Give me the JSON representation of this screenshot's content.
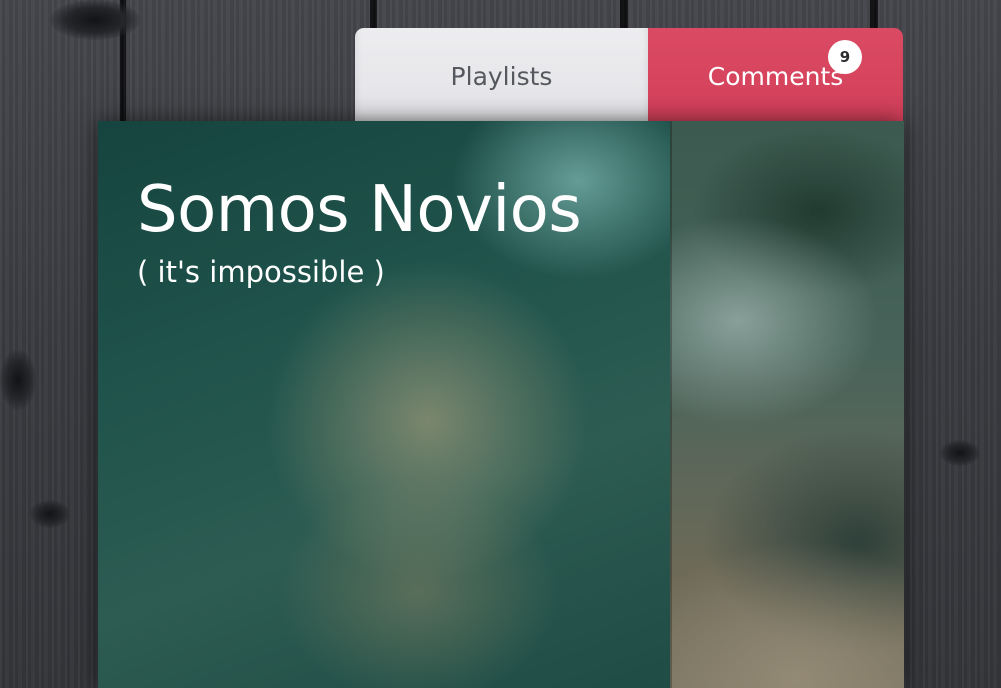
{
  "tabs": {
    "playlists_label": "Playlists",
    "comments_label": "Comments",
    "comments_count": "9",
    "active_tab": "Comments"
  },
  "card": {
    "title": "Somos Novios",
    "subtitle": "( it's impossible )"
  },
  "colors": {
    "comments_tab": "#d84660",
    "playlists_tab": "#e8e8eb",
    "badge": "#ffffff",
    "wood_background": "#3c3e43"
  }
}
